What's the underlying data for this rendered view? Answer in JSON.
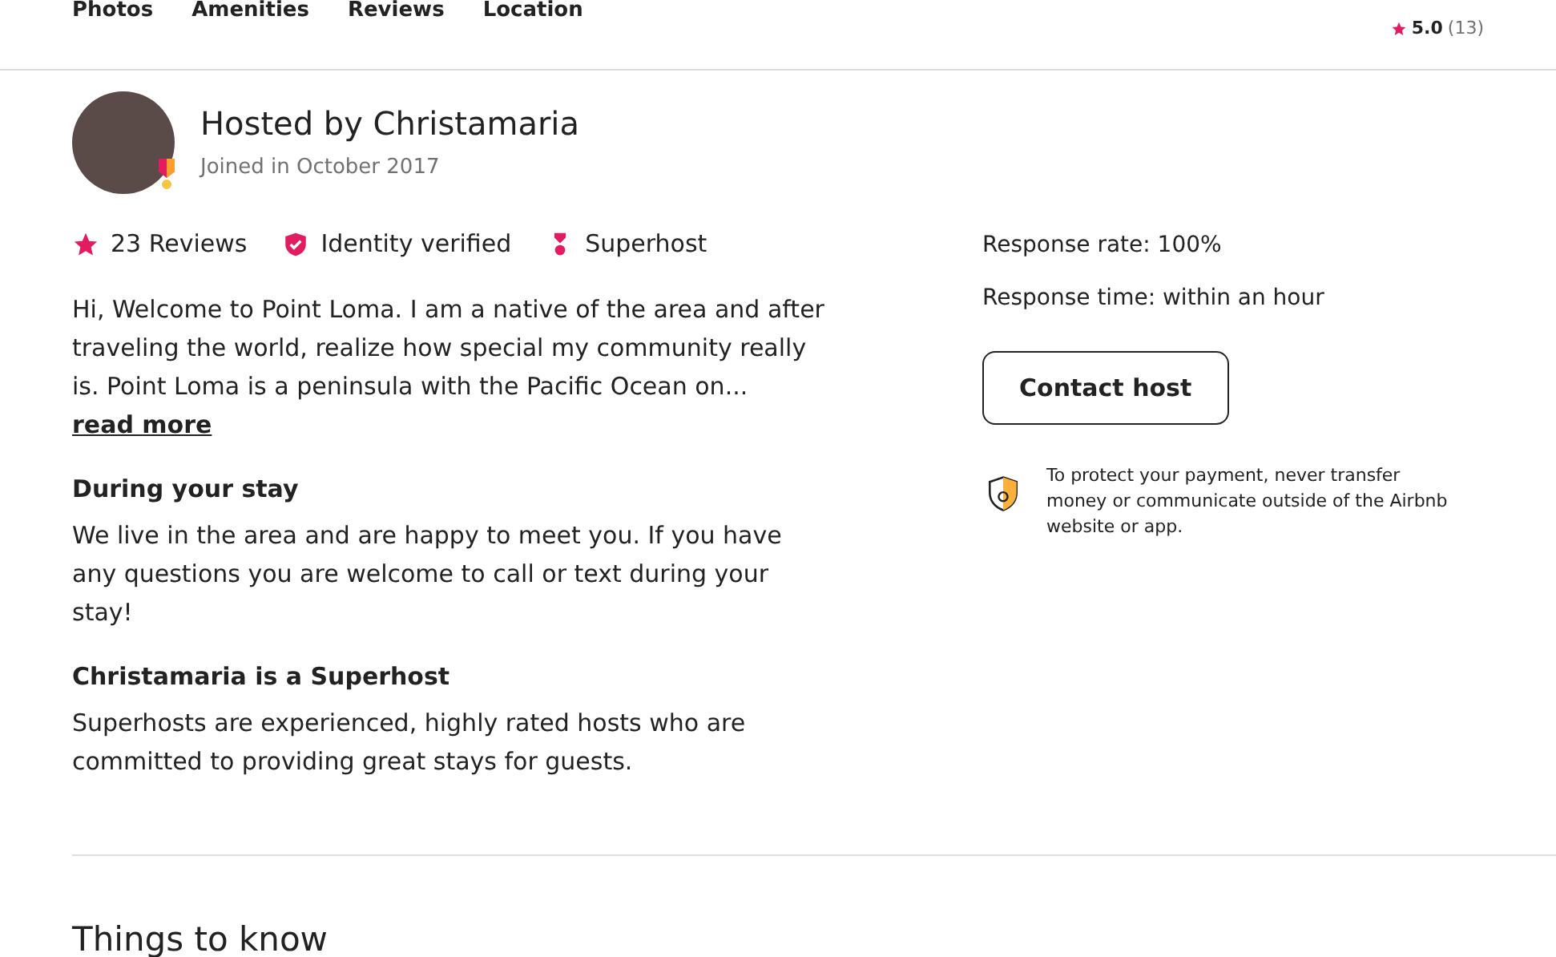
{
  "nav": {
    "links": [
      {
        "label": "Photos"
      },
      {
        "label": "Amenities"
      },
      {
        "label": "Reviews"
      },
      {
        "label": "Location"
      }
    ],
    "rating": "5.0",
    "review_count": "(13)"
  },
  "host": {
    "title": "Hosted by Christamaria",
    "joined": "Joined in October 2017",
    "superhost": true,
    "badges": [
      {
        "kind": "star",
        "label": "23 Reviews"
      },
      {
        "kind": "shield",
        "label": "Identity verified"
      },
      {
        "kind": "medal",
        "label": "Superhost"
      }
    ],
    "about": "Hi, Welcome to Point Loma. I am a native of the area and after traveling the world, realize how special my community really is. Point Loma is a peninsula with the Pacific Ocean on...",
    "read_more": "read more",
    "sections": [
      {
        "heading": "During your stay",
        "text": "We live in the area and are happy to meet you. If you have any questions you are welcome to call or text during your stay!"
      },
      {
        "heading": "Christamaria is a Superhost",
        "text": "Superhosts are experienced, highly rated hosts who are committed to providing great stays for guests."
      }
    ],
    "response_rate": "Response rate: 100%",
    "response_time": "Response time: within an hour",
    "contact_button": "Contact host",
    "payment_notice": "To protect your payment, never transfer money or communicate outside of the Airbnb website or app."
  },
  "next_heading": "Things to know"
}
